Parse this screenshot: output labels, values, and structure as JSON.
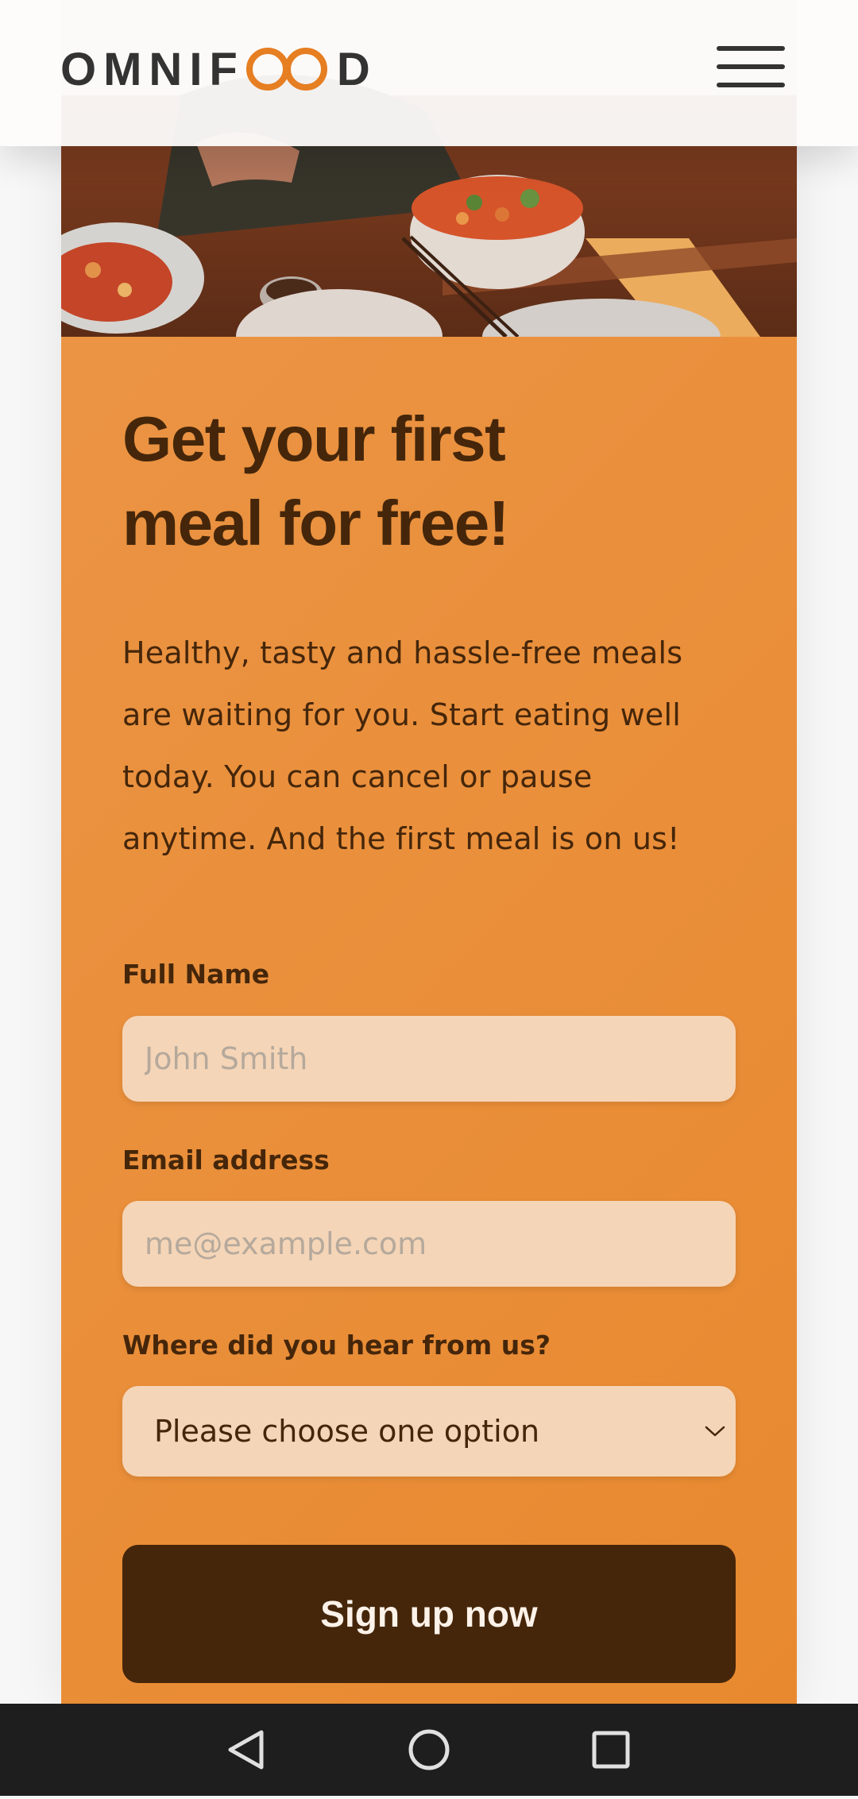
{
  "header": {
    "logo_text_left": "OMNIF",
    "logo_text_right": "D",
    "brand_color": "#e67e22",
    "menu_icon": "hamburger-menu-icon"
  },
  "cta": {
    "heading_line1": "Get your first",
    "heading_line2": "meal for free!",
    "description": "Healthy, tasty and hassle-free meals are waiting for you. Start eating well today. You can cancel or pause anytime. And the first meal is on us!",
    "form": {
      "full_name_label": "Full Name",
      "full_name_placeholder": "John Smith",
      "full_name_value": "",
      "email_label": "Email address",
      "email_placeholder": "me@example.com",
      "email_value": "",
      "source_label": "Where did you hear from us?",
      "source_selected": "Please choose one option",
      "submit_label": "Sign up now"
    },
    "colors": {
      "panel": "#e98b35",
      "text_dark": "#45260a",
      "input_bg": "#f5d5b7",
      "button_bg": "#45260a",
      "button_text": "#fdf2e9"
    }
  },
  "system_nav": {
    "back_icon": "back-triangle-icon",
    "home_icon": "home-circle-icon",
    "recents_icon": "recents-square-icon"
  }
}
